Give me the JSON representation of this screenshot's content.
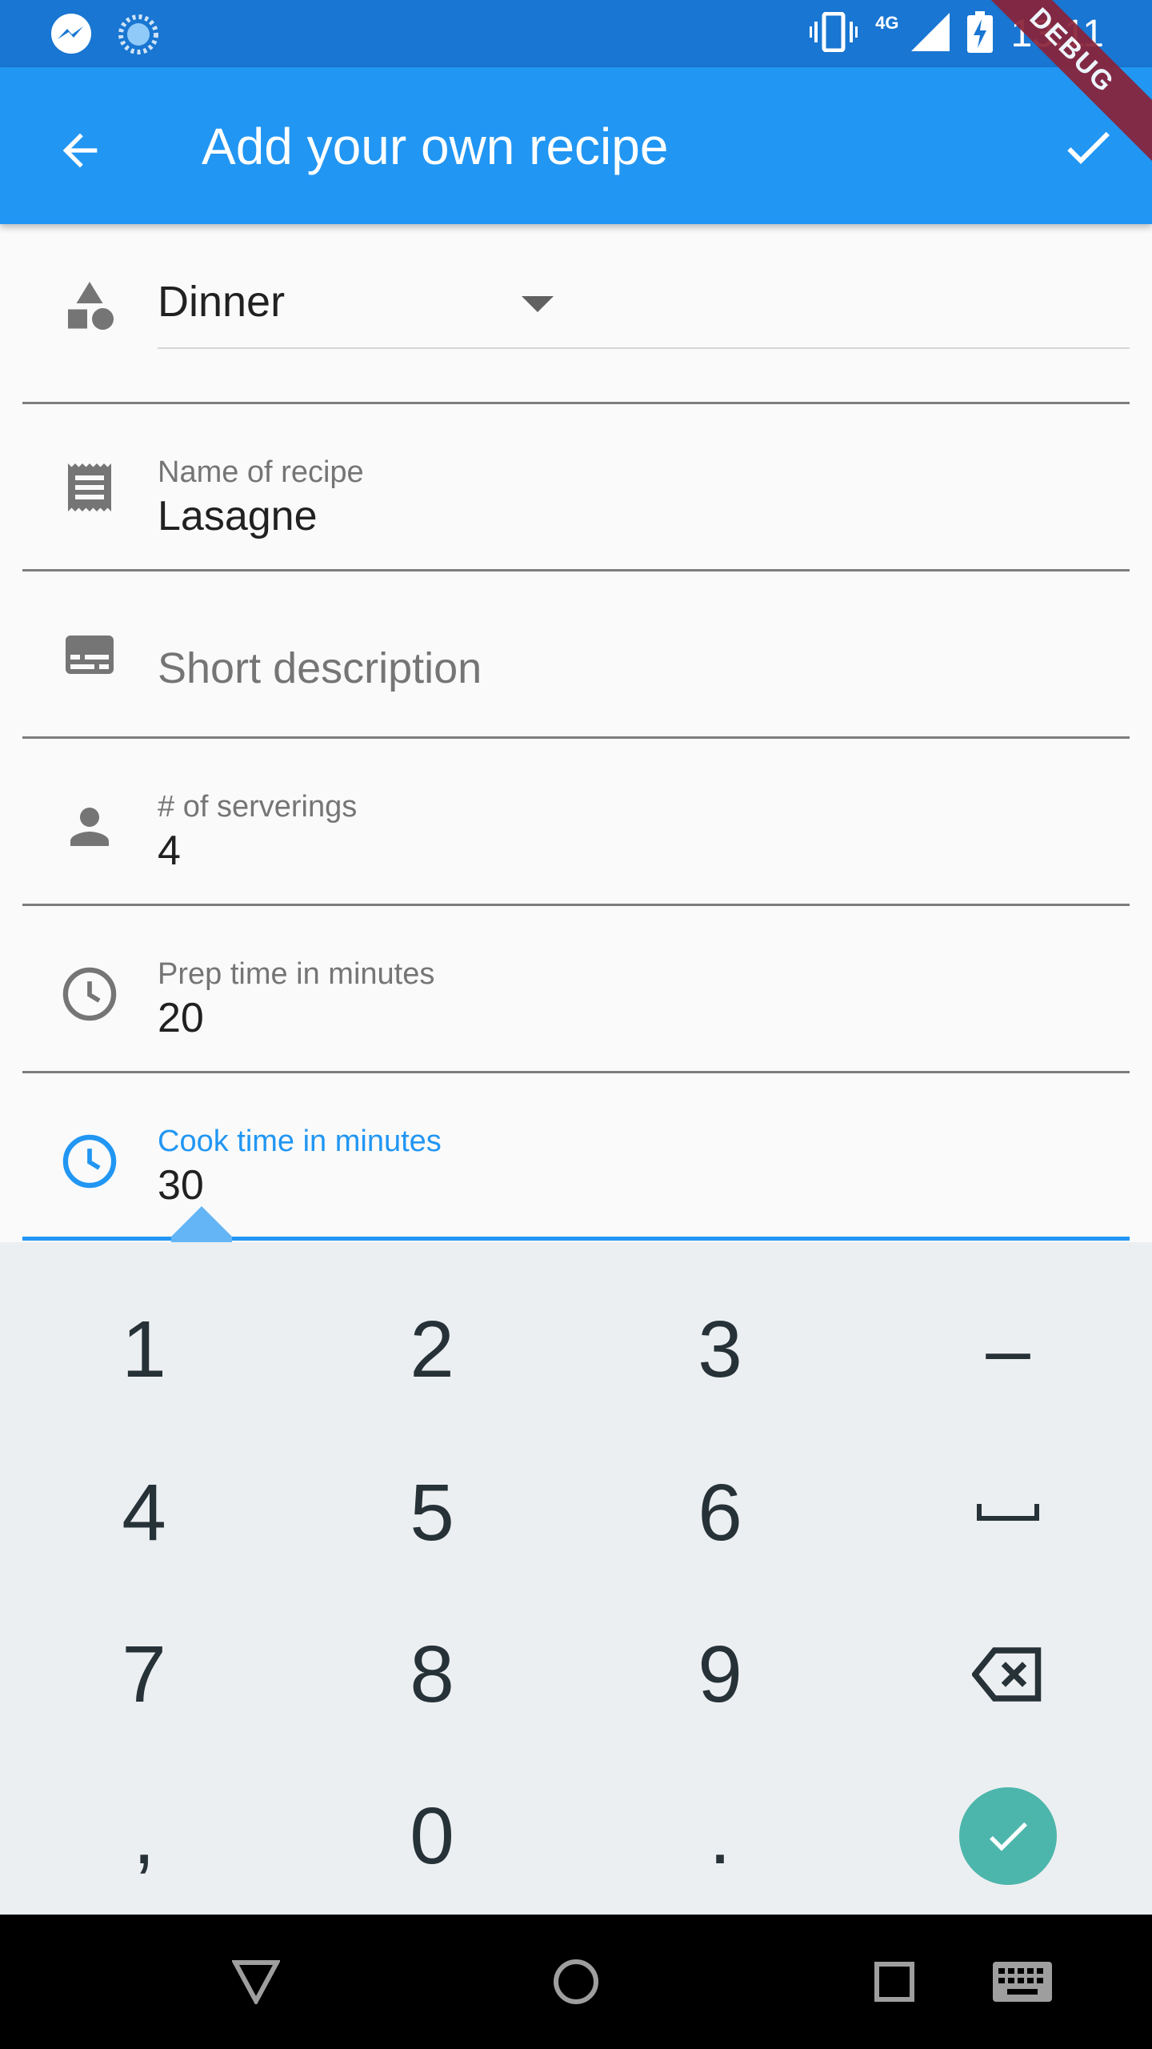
{
  "status_bar": {
    "time": "13:11",
    "network": "4G"
  },
  "debug_banner": "DEBUG",
  "app_bar": {
    "title": "Add your own recipe",
    "back_icon": "arrow-back-icon",
    "confirm_icon": "check-icon"
  },
  "form": {
    "category": {
      "value": "Dinner",
      "icon": "category-shapes-icon"
    },
    "name": {
      "label": "Name of recipe",
      "value": "Lasagne",
      "icon": "receipt-icon"
    },
    "description": {
      "placeholder": "Short description",
      "icon": "subtitles-icon"
    },
    "servings": {
      "label": "# of serverings",
      "value": "4",
      "icon": "person-icon"
    },
    "prep_time": {
      "label": "Prep time in minutes",
      "value": "20",
      "icon": "clock-icon"
    },
    "cook_time": {
      "label": "Cook time in minutes",
      "value": "30",
      "icon": "clock-icon"
    }
  },
  "keyboard": {
    "keys": [
      "1",
      "2",
      "3",
      "–",
      "4",
      "5",
      "6",
      "space",
      "7",
      "8",
      "9",
      "backspace",
      ",",
      "0",
      ".",
      "done"
    ]
  },
  "colors": {
    "primary": "#2196f3",
    "primary_dark": "#1976d2",
    "accent_key": "#4db6ac",
    "keyboard_bg": "#eceff1",
    "debug_ribbon": "#8a2238"
  }
}
